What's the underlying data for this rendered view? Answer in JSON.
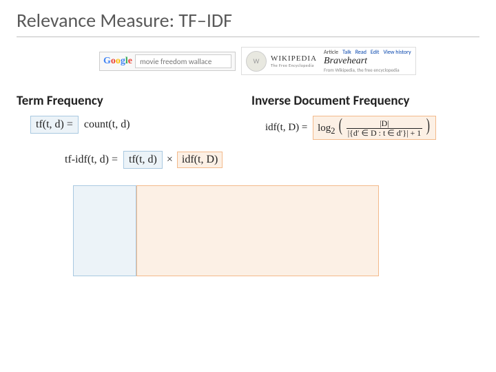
{
  "title": "Relevance Measure: TF–IDF",
  "logos": {
    "google_query": "movie freedom wallace",
    "wiki_name": "WIKIPEDIA",
    "wiki_sub": "The Free Encyclopedia",
    "wiki_tabs": {
      "article": "Article",
      "talk": "Talk",
      "read": "Read",
      "edit": "Edit",
      "history": "View history"
    },
    "wiki_article": "Braveheart",
    "wiki_from": "From Wikipedia, the free encyclopedia"
  },
  "tf": {
    "heading": "Term Frequency",
    "lhs": "tf(t, d) =",
    "rhs": "count(t, d)"
  },
  "idf": {
    "heading": "Inverse Document Frequency",
    "lhs": "idf(t, D) =",
    "log": "log",
    "logsub": "2",
    "num": "|D|",
    "den": "|{d′ ∈ D : t ∈ d′}| + 1"
  },
  "combined": {
    "lhs": "tf-idf(t, d) =",
    "tf": "tf(t, d)",
    "times": "×",
    "idf": "idf(t, D)"
  }
}
